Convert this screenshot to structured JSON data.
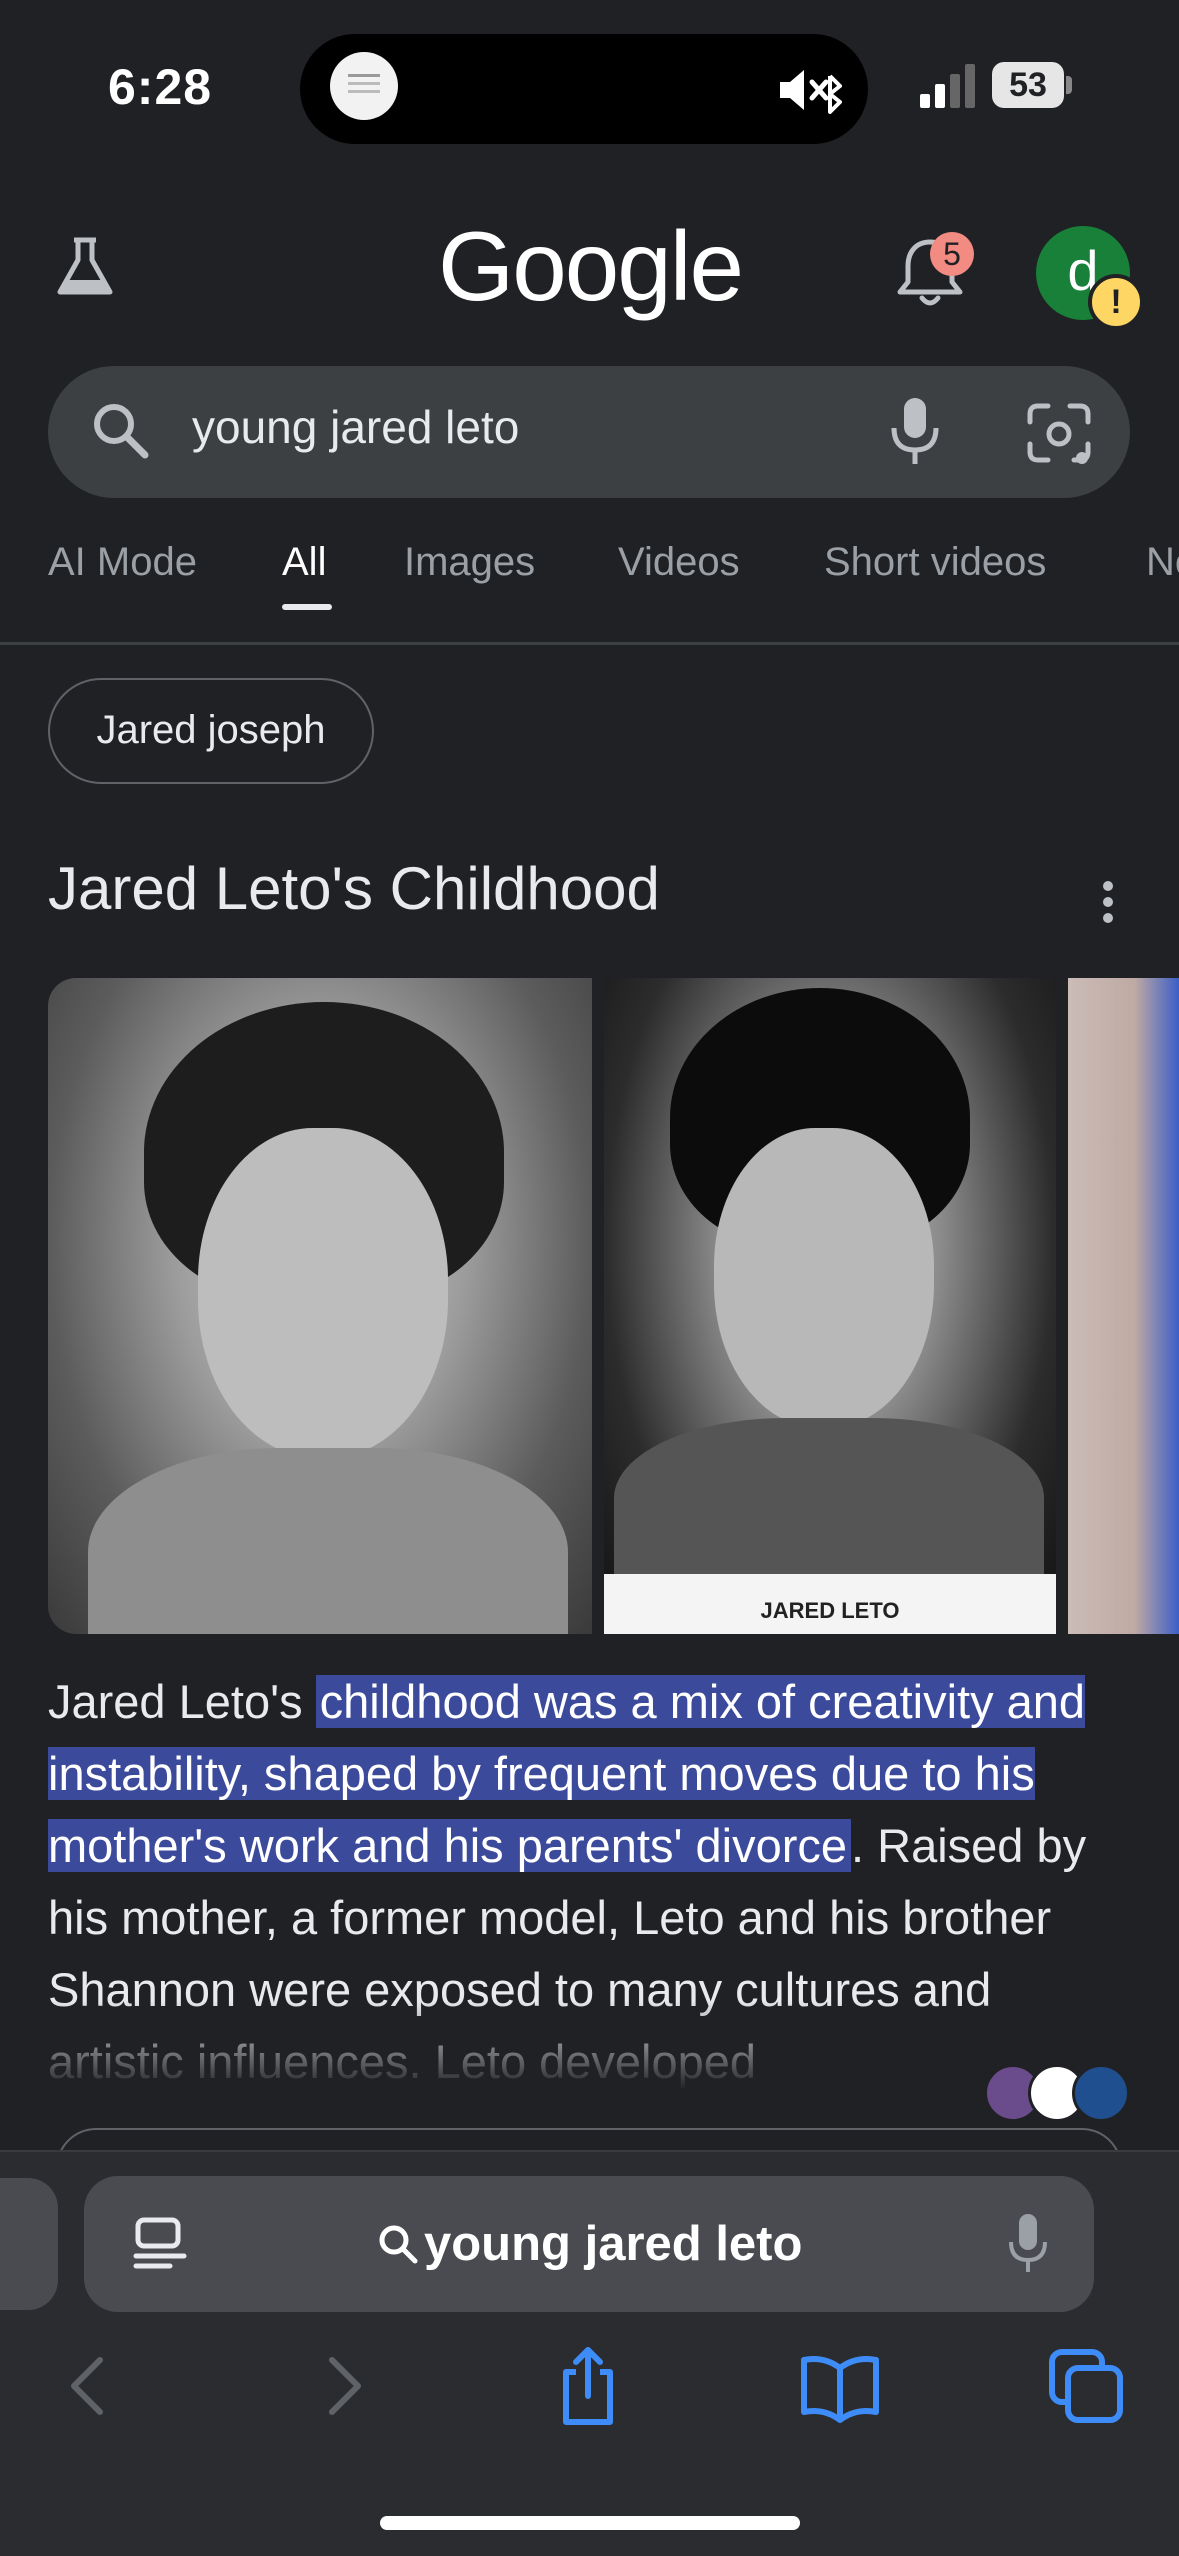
{
  "status_bar": {
    "time": "6:28",
    "battery": "53",
    "icons": [
      "mute-icon",
      "bluetooth-icon",
      "signal-icon",
      "battery-icon"
    ]
  },
  "header": {
    "logo": "Google",
    "notification_count": "5",
    "avatar_letter": "d",
    "avatar_warning": "!",
    "colors": {
      "avatar": "#188038",
      "badge": "#f28b82",
      "warning": "#fdd663"
    }
  },
  "search": {
    "query": "young jared leto"
  },
  "tabs": [
    {
      "label": "AI Mode"
    },
    {
      "label": "All",
      "active": true
    },
    {
      "label": "Images"
    },
    {
      "label": "Videos"
    },
    {
      "label": "Short videos"
    },
    {
      "label": "Ne"
    }
  ],
  "chip": {
    "label": "Jared joseph"
  },
  "section": {
    "title": "Jared Leto's Childhood",
    "photo_caption": "JARED LETO"
  },
  "overview": {
    "intro": "Jared Leto's ",
    "highlight": "childhood was a mix of creativity and instability, shaped by frequent moves due to his mother's work and his parents' divorce",
    "rest": ". Raised by his mother, a former model, Leto and his brother Shannon were exposed to many cultures and artistic influences. Leto developed"
  },
  "browser": {
    "address_text": "young jared leto",
    "accent_color": "#3e8cf7"
  }
}
